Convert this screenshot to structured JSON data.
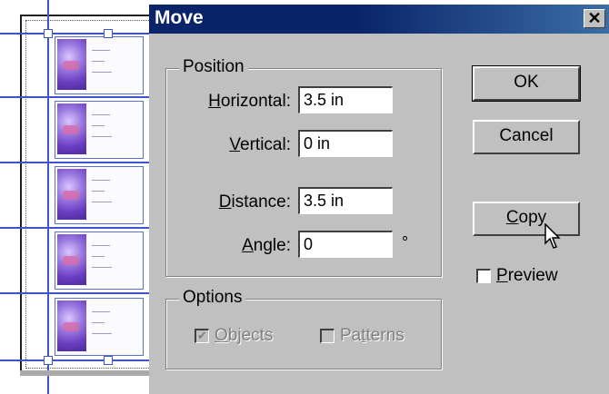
{
  "dialog": {
    "title": "Move",
    "close_glyph": "✕",
    "position_group": {
      "legend": "Position",
      "horizontal": {
        "label_key": "H",
        "label_rest": "orizontal:",
        "value": "3.5 in"
      },
      "vertical": {
        "label_key": "V",
        "label_rest": "ertical:",
        "value": "0 in"
      },
      "distance": {
        "label_key": "D",
        "label_rest": "istance:",
        "value": "3.5 in"
      },
      "angle": {
        "label_key": "A",
        "label_rest": "ngle:",
        "value": "0",
        "unit": "°"
      }
    },
    "options_group": {
      "legend": "Options",
      "objects": {
        "label_key": "O",
        "label_rest": "bjects",
        "checked": true,
        "enabled": false
      },
      "patterns": {
        "label_pre": "Pa",
        "label_key": "t",
        "label_rest": "terns",
        "checked": false,
        "enabled": false
      }
    },
    "buttons": {
      "ok": "OK",
      "cancel": "Cancel",
      "copy_key": "C",
      "copy_rest": "opy"
    },
    "preview": {
      "label_key": "P",
      "label_rest": "review",
      "checked": false
    }
  },
  "colors": {
    "titlebar": "#0a246a",
    "dialog_bg": "#c0c0c0",
    "guide": "#3d55c8"
  },
  "icons": [
    "close-icon",
    "checkbox-checked-icon",
    "checkbox-unchecked-icon",
    "hand-pointer-cursor-icon"
  ]
}
